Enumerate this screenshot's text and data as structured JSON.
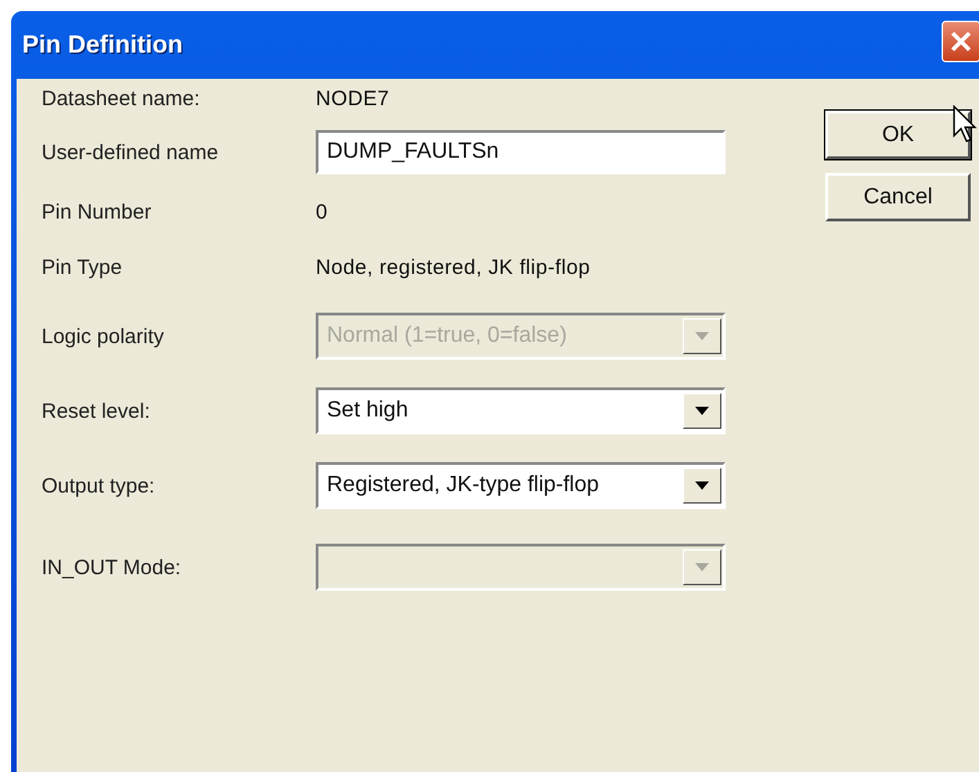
{
  "window": {
    "title": "Pin Definition"
  },
  "fields": [
    {
      "kind": "text",
      "label": "Datasheet name:",
      "value": "NODE7"
    },
    {
      "kind": "input",
      "label": "User-defined name",
      "value": "DUMP_FAULTSn"
    },
    {
      "kind": "text",
      "label": "Pin Number",
      "value": "0"
    },
    {
      "kind": "text",
      "label": "Pin Type",
      "value": "Node, registered, JK flip-flop"
    },
    {
      "kind": "combo",
      "label": "Logic polarity",
      "value": "Normal (1=true, 0=false)",
      "disabled": true
    },
    {
      "kind": "combo",
      "label": "Reset level:",
      "value": "Set high",
      "disabled": false
    },
    {
      "kind": "combo",
      "label": "Output type:",
      "value": "Registered, JK-type flip-flop",
      "disabled": false
    },
    {
      "kind": "combo",
      "label": "IN_OUT Mode:",
      "disabled": true
    }
  ],
  "buttons": [
    {
      "label": "OK",
      "default": true
    },
    {
      "label": "Cancel",
      "default": false
    }
  ]
}
